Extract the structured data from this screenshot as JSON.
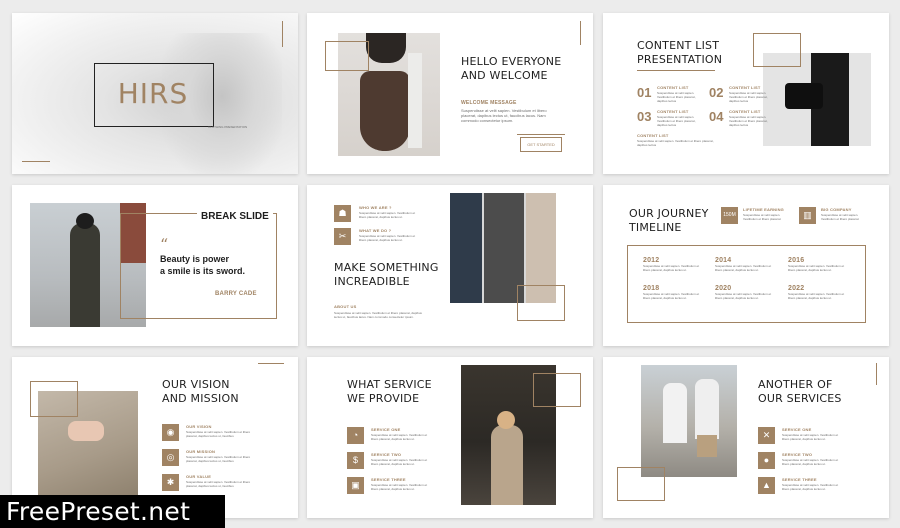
{
  "slides": {
    "s1": {
      "brand": "HIRS",
      "subtitle": "CLOTHING PRESENTATION"
    },
    "s2": {
      "title_line1": "HELLO EVERYONE",
      "title_line2": "AND WELCOME",
      "label": "WELCOME MESSAGE",
      "body": "Suspendisse at velit sapien. Vestibulum et libero placerat, dapibus lectus ut, faucibus lacus. Nam commodo consectetur ipsum.",
      "button": "GET STARTED"
    },
    "s3": {
      "title_line1": "CONTENT LIST",
      "title_line2": "PRESENTATION",
      "items": [
        {
          "num": "01",
          "label": "CONTENT LIST",
          "text": "Suspendisse at velit sapien. Vestibulum et libero placerat, dapibus lectus"
        },
        {
          "num": "02",
          "label": "CONTENT LIST",
          "text": "Suspendisse at velit sapien. Vestibulum et libero placerat, dapibus lectus"
        },
        {
          "num": "03",
          "label": "CONTENT LIST",
          "text": "Suspendisse at velit sapien. Vestibulum et libero placerat, dapibus lectus"
        },
        {
          "num": "04",
          "label": "CONTENT LIST",
          "text": "Suspendisse at velit sapien. Vestibulum et libero placerat, dapibus lectus"
        }
      ],
      "footer_label": "CONTENT LIST",
      "footer_text": "Suspendisse at velit sapien. Vestibulum et libero placerat, dapibus lectus"
    },
    "s4": {
      "title": "BREAK SLIDE",
      "quote_mark": "“",
      "quote_line1": "Beauty is power",
      "quote_line2": "a smile is its sword.",
      "author": "BARRY CADE"
    },
    "s5": {
      "items": [
        {
          "label": "WHO WE ARE ?",
          "text": "Suspendisse at velit sapien. Vestibulum et libero placerat, dapibus lectus ut."
        },
        {
          "label": "WHAT WE DO ?",
          "text": "Suspendisse at velit sapien. Vestibulum et libero placerat, dapibus lectus ut."
        }
      ],
      "title_line1": "MAKE SOMETHING",
      "title_line2": "INCREADIBLE",
      "about_label": "ABOUT US",
      "about_text": "Suspendisse at velit sapien. Vestibulum et libero placerat, dapibus lectus ut, faucibus lacus. Nam commodo consectetur ipsum."
    },
    "s6": {
      "title_line1": "OUR JOURNEY",
      "title_line2": "TIMELINE",
      "badge": "150M",
      "stat1_label": "LIFETIME EARNING",
      "stat1_text": "Suspendisse at velit sapien. Vestibulum et libero placerat",
      "stat2_label": "BIG COMPANY",
      "stat2_text": "Suspendisse at velit sapien. Vestibulum et libero placerat",
      "years": [
        {
          "year": "2012",
          "text": "Suspendisse at velit sapien. Vestibulum et libero placerat, dapibus lectus ut."
        },
        {
          "year": "2014",
          "text": "Suspendisse at velit sapien. Vestibulum et libero placerat, dapibus lectus ut."
        },
        {
          "year": "2016",
          "text": "Suspendisse at velit sapien. Vestibulum et libero placerat, dapibus lectus ut."
        },
        {
          "year": "2018",
          "text": "Suspendisse at velit sapien. Vestibulum et libero placerat, dapibus lectus ut."
        },
        {
          "year": "2020",
          "text": "Suspendisse at velit sapien. Vestibulum et libero placerat, dapibus lectus ut."
        },
        {
          "year": "2022",
          "text": "Suspendisse at velit sapien. Vestibulum et libero placerat, dapibus lectus ut."
        }
      ]
    },
    "s7": {
      "title_line1": "OUR VISION",
      "title_line2": "AND MISSION",
      "items": [
        {
          "label": "OUR VISION",
          "text": "Suspendisse at velit sapien. Vestibulum et libero placerat, dapibus lectus ut, faucibus"
        },
        {
          "label": "OUR MISSION",
          "text": "Suspendisse at velit sapien. Vestibulum et libero placerat, dapibus lectus ut, faucibus"
        },
        {
          "label": "OUR VALUE",
          "text": "Suspendisse at velit sapien. Vestibulum et libero placerat, dapibus lectus ut, faucibus"
        }
      ]
    },
    "s8": {
      "title_line1": "WHAT SERVICE",
      "title_line2": "WE PROVIDE",
      "items": [
        {
          "label": "SERVICE ONE",
          "text": "Suspendisse at velit sapien. Vestibulum et libero placerat, dapibus lectus ut."
        },
        {
          "label": "SERVICE TWO",
          "text": "Suspendisse at velit sapien. Vestibulum et libero placerat, dapibus lectus ut."
        },
        {
          "label": "SERVICE THREE",
          "text": "Suspendisse at velit sapien. Vestibulum et libero placerat, dapibus lectus ut."
        }
      ]
    },
    "s9": {
      "title_line1": "ANOTHER OF",
      "title_line2": "OUR SERVICES",
      "items": [
        {
          "label": "SERVICE ONE",
          "text": "Suspendisse at velit sapien. Vestibulum et libero placerat, dapibus lectus ut."
        },
        {
          "label": "SERVICE TWO",
          "text": "Suspendisse at velit sapien. Vestibulum et libero placerat, dapibus lectus ut."
        },
        {
          "label": "SERVICE THREE",
          "text": "Suspendisse at velit sapien. Vestibulum et libero placerat, dapibus lectus ut."
        }
      ]
    }
  },
  "watermark": "FreePreset.net",
  "colors": {
    "accent": "#a08363",
    "background": "#ececec",
    "slide": "#ffffff",
    "text": "#1e1e1e"
  }
}
